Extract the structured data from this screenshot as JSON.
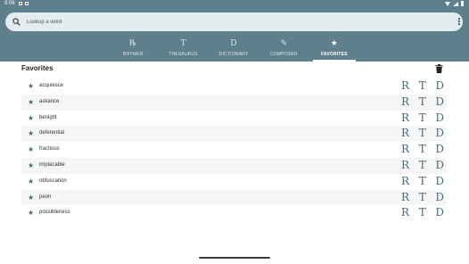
{
  "status_bar": {
    "time": "9:06"
  },
  "search": {
    "placeholder": "Lookup a word"
  },
  "tabs": [
    {
      "icon": "℞",
      "label": "RHYMER",
      "active": false
    },
    {
      "icon": "T",
      "label": "THESAURUS",
      "active": false
    },
    {
      "icon": "D",
      "label": "DICTIONARY",
      "active": false
    },
    {
      "icon": "✎",
      "label": "COMPOSER",
      "active": false
    },
    {
      "icon": "★",
      "label": "FAVORITES",
      "active": true
    }
  ],
  "favorites": {
    "title": "Favorites",
    "actions": [
      "R",
      "T",
      "D"
    ],
    "words": [
      "acquiesce",
      "askance",
      "benight",
      "deferential",
      "fractious",
      "implacable",
      "obfuscation",
      "peon",
      "possibleness"
    ]
  },
  "colors": {
    "header": "#5e7f8c",
    "accent": "#4a6a78"
  }
}
